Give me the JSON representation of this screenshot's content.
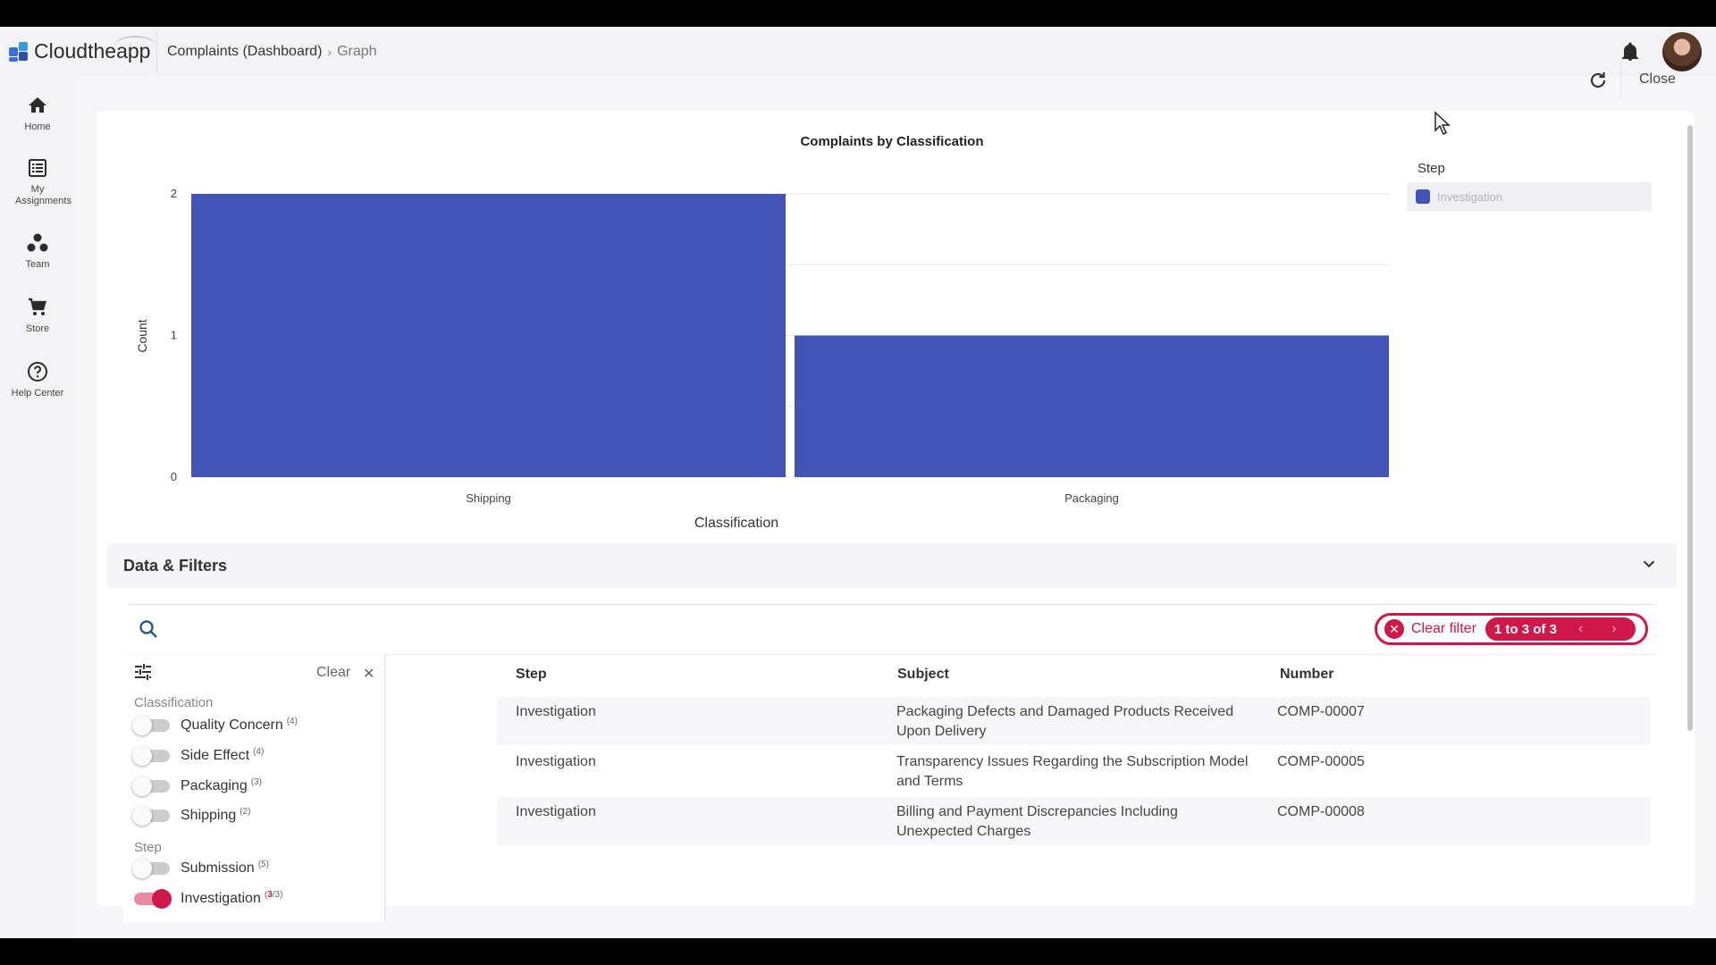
{
  "app": {
    "brand": "Cloudtheapp",
    "breadcrumb": [
      "Complaints (Dashboard)",
      "Graph"
    ]
  },
  "nav": [
    {
      "label": "Home",
      "icon": "home-icon"
    },
    {
      "label": "My Assignments",
      "icon": "list-icon"
    },
    {
      "label": "Team",
      "icon": "team-icon"
    },
    {
      "label": "Store",
      "icon": "cart-icon"
    },
    {
      "label": "Help Center",
      "icon": "help-icon"
    }
  ],
  "header": {
    "close_label": "Close"
  },
  "colors": {
    "accent": "#d0174a",
    "bar": "#4254b5"
  },
  "chart_data": {
    "type": "bar",
    "title": "Complaints by Classification",
    "xlabel": "Classification",
    "ylabel": "Count",
    "categories": [
      "Shipping",
      "Packaging"
    ],
    "series": [
      {
        "name": "Investigation",
        "values": [
          2,
          1
        ]
      }
    ],
    "ylim": [
      0,
      2
    ],
    "yticks": [
      0,
      1,
      2
    ],
    "legend_title": "Step",
    "legend_position": "right",
    "grid": true
  },
  "data_filters": {
    "title": "Data & Filters",
    "clear_filter_label": "Clear filter",
    "pagination": "1 to 3 of 3"
  },
  "table": {
    "columns": [
      "Step",
      "Subject",
      "Number"
    ],
    "rows": [
      {
        "step": "Investigation",
        "subject_1": "Packaging Defects and Damaged Products Received",
        "subject_2": "Upon Delivery",
        "number": "COMP-00007"
      },
      {
        "step": "Investigation",
        "subject_1": "Transparency Issues Regarding the Subscription Model",
        "subject_2": "and Terms",
        "number": "COMP-00005"
      },
      {
        "step": "Investigation",
        "subject_1": "Billing and Payment Discrepancies Including",
        "subject_2": "Unexpected Charges",
        "number": "COMP-00008"
      }
    ]
  },
  "filter_panel": {
    "clear_label": "Clear",
    "groups": [
      {
        "title": "Classification",
        "items": [
          {
            "label": "Quality Concern",
            "count": "(4)",
            "on": false
          },
          {
            "label": "Side Effect",
            "count": "(4)",
            "on": false
          },
          {
            "label": "Packaging",
            "count": "(3)",
            "on": false
          },
          {
            "label": "Shipping",
            "count": "(2)",
            "on": false
          }
        ]
      },
      {
        "title": "Step",
        "items": [
          {
            "label": "Submission",
            "count": "(5)",
            "on": false
          },
          {
            "label": "Investigation",
            "count_selected": "3",
            "count_total": "/3)",
            "count_open": "(",
            "on": true
          }
        ]
      }
    ]
  }
}
